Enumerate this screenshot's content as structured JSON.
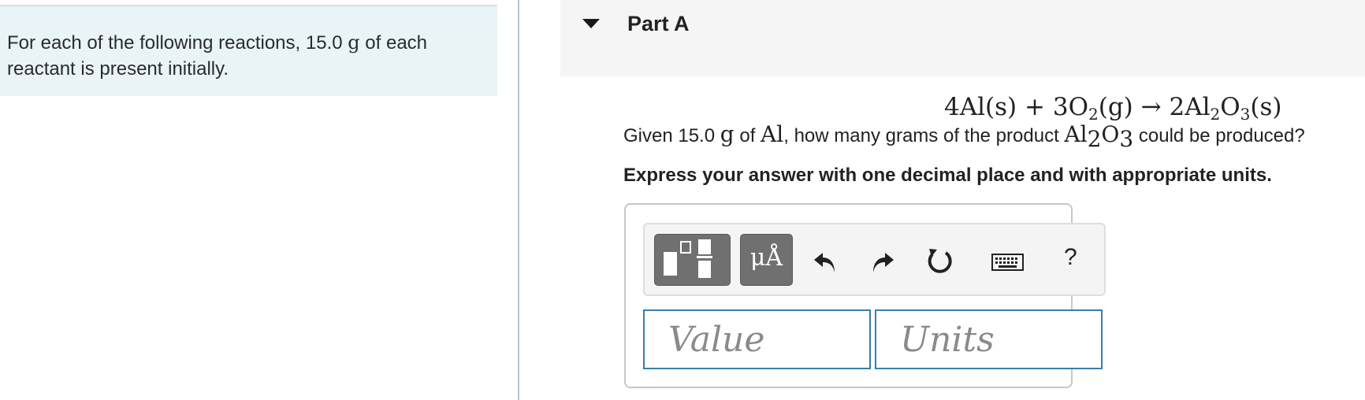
{
  "intro": {
    "text_before": "For each of the following reactions, 15.0 ",
    "mass_unit": "g",
    "text_after": " of each reactant is present initially."
  },
  "part": {
    "title": "Part A"
  },
  "problem": {
    "equation": {
      "r1_coef": "4",
      "r1_sym": "Al",
      "r1_state": "(s)",
      "plus": " + ",
      "r2_coef": "3",
      "r2_sym": "O",
      "r2_sub": "2",
      "r2_state": "(g)",
      "arrow": " → ",
      "p_coef": "2",
      "p_sym1": "Al",
      "p_sub1": "2",
      "p_sym2": "O",
      "p_sub2": "3",
      "p_state": "(s)"
    },
    "question": {
      "t1": "Given 15.0 ",
      "unit": "g",
      "t2": " of ",
      "reactant": "Al",
      "t3": ", how many grams of the product ",
      "prod_sym1": "Al",
      "prod_sub1": "2",
      "prod_sym2": "O",
      "prod_sub2": "3",
      "t4": " could be produced?"
    },
    "instruction": "Express your answer with one decimal place and with appropriate units."
  },
  "toolbar": {
    "units_symbol": "μÅ",
    "help_label": "?",
    "icons": [
      "templates-icon",
      "undo-icon",
      "redo-icon",
      "reset-icon",
      "keyboard-icon"
    ]
  },
  "answer": {
    "value_placeholder": "Value",
    "units_placeholder": "Units",
    "value": "",
    "units": ""
  },
  "colors": {
    "intro_bg": "#e8f4f6",
    "header_bg": "#f5f5f5",
    "toolbar_btn": "#707070",
    "input_border": "#3a7ea8"
  }
}
